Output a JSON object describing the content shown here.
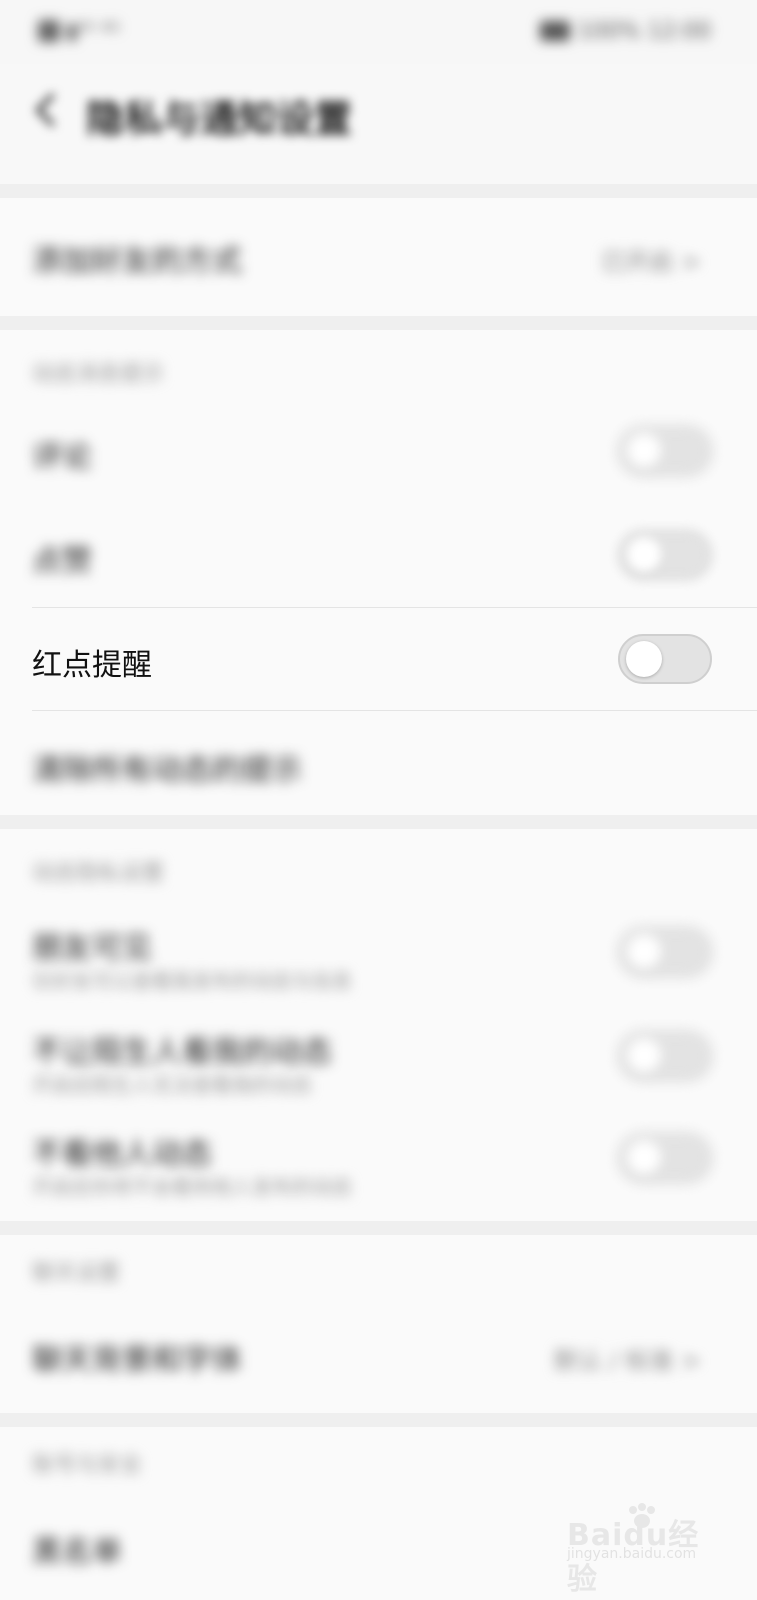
{
  "status_bar": {
    "left_text": "▮ᴵˡᴵˡ ⁴ᴳ",
    "right_text": "100% 12:00"
  },
  "header": {
    "title": "隐私与通知设置"
  },
  "section1": {
    "row_label": "添加好友的方式",
    "row_value": "已开启 >"
  },
  "section2": {
    "header": "动态消息提示",
    "rows": [
      {
        "label": "评论"
      },
      {
        "label": "点赞"
      },
      {
        "label": "红点提醒"
      }
    ],
    "clear_label": "清除所有动态的提示"
  },
  "section3": {
    "header": "动态隐私设置",
    "rows": [
      {
        "label": "朋友可见",
        "sub": "仅好友可以查看我发布的动态与信息"
      },
      {
        "label": "不让陌生人看我的动态",
        "sub": "开启后陌生人无法查看我的动态"
      },
      {
        "label": "不看他人动态",
        "sub": "开启后你将不会看到他人发布的动态"
      }
    ]
  },
  "section4": {
    "header": "聊天设置",
    "row_label": "聊天背景和字体",
    "row_value": "默认 / 标准 >"
  },
  "section5": {
    "header": "账号与安全",
    "row_label": "黑名单"
  },
  "watermark": {
    "brand": "Baidu经验",
    "url": "jingyan.baidu.com"
  },
  "colors": {
    "toggle_off_track": "#e3e3e3",
    "background": "#f7f7f7"
  }
}
